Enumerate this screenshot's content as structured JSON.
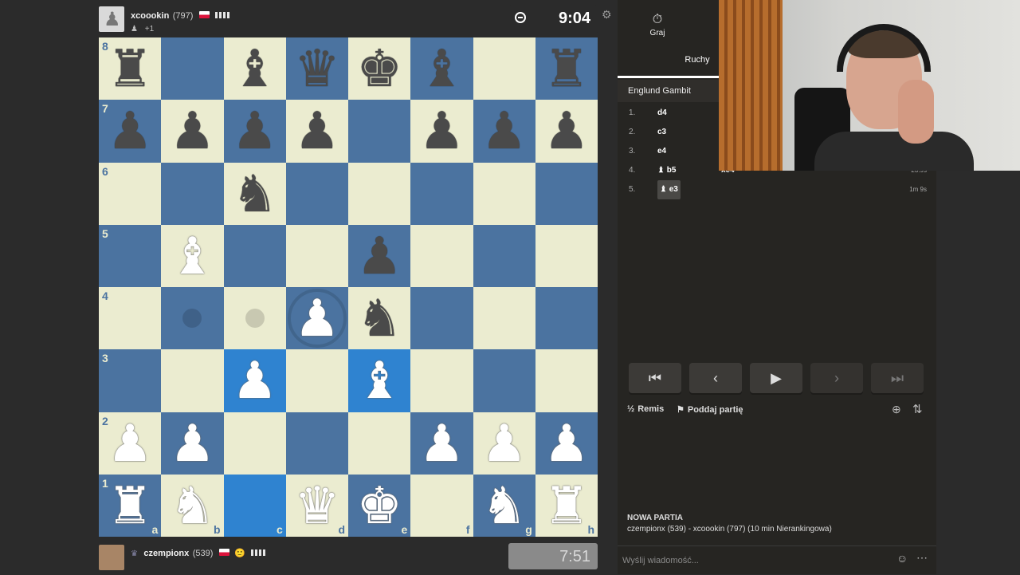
{
  "top_player": {
    "name": "xcoookin",
    "rating": "(797)",
    "sub": "+1",
    "clock": "9:04"
  },
  "bottom_player": {
    "name": "czempionx",
    "rating": "(539)",
    "clock": "7:51"
  },
  "board": {
    "ranks": [
      "8",
      "7",
      "6",
      "5",
      "4",
      "3",
      "2",
      "1"
    ],
    "files": [
      "a",
      "b",
      "c",
      "d",
      "e",
      "f",
      "g",
      "h"
    ],
    "squares": [
      [
        "r",
        "",
        "b",
        "q",
        "k",
        "b",
        "",
        "r"
      ],
      [
        "p",
        "p",
        "p",
        "p",
        "",
        "p",
        "p",
        "p"
      ],
      [
        "",
        "",
        "n",
        "",
        "",
        "",
        "",
        ""
      ],
      [
        "",
        "B",
        "",
        "",
        "p",
        "",
        "",
        ""
      ],
      [
        "",
        "",
        "",
        "P",
        "n",
        "",
        "",
        ""
      ],
      [
        "",
        "",
        "P",
        "",
        "B",
        "",
        "",
        ""
      ],
      [
        "P",
        "P",
        "",
        "",
        "",
        "P",
        "P",
        "P"
      ],
      [
        "R",
        "N",
        "",
        "Q",
        "K",
        "",
        "N",
        "R"
      ]
    ],
    "highlighted": [
      "c3",
      "e3",
      "c1"
    ],
    "move_hints": [
      "b4",
      "c4"
    ],
    "selected_ring": "d4"
  },
  "panel": {
    "tab_play": "Graj",
    "tab_moves": "Ruchy",
    "opening": "Englund Gambit",
    "moves": [
      {
        "no": "1.",
        "white": "d4",
        "black": "",
        "time": ""
      },
      {
        "no": "2.",
        "white": "c3",
        "black": "",
        "time": ""
      },
      {
        "no": "3.",
        "white": "e4",
        "black": "",
        "time": ""
      },
      {
        "no": "4.",
        "white": "b5",
        "black": "xe4",
        "time": "23.9s",
        "white_piece": "♝"
      },
      {
        "no": "5.",
        "white": "e3",
        "black": "",
        "time": "1m 9s",
        "white_piece": "♝"
      }
    ],
    "draw_label": "Remis",
    "draw_icon": "½",
    "resign_label": "Poddaj partię",
    "new_game_title": "NOWA PARTIA",
    "new_game_desc": "czempionx (539) - xcoookin (797) (10 min Nierankingowa)",
    "chat_placeholder": "Wyślij wiadomość..."
  },
  "colors": {
    "light_square": "#ebecd0",
    "dark_square": "#4b73a0",
    "highlight": "#2f83d0",
    "panel_bg": "#262522"
  }
}
